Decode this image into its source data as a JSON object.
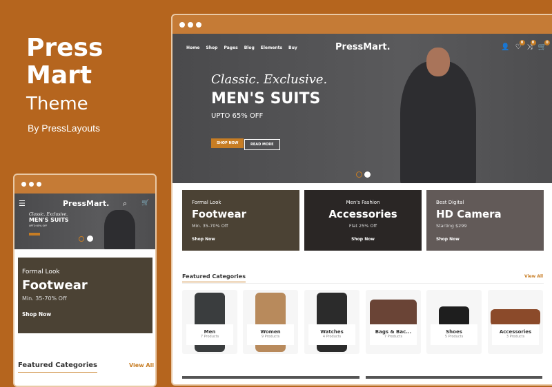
{
  "promo": {
    "title_line1": "Press",
    "title_line2": "Mart",
    "subtitle": "Theme",
    "byline": "By PressLayouts"
  },
  "desktop": {
    "nav": [
      "Home",
      "Shop",
      "Pages",
      "Blog",
      "Elements",
      "Buy"
    ],
    "logo": "PressMart.",
    "badges": {
      "wishlist": "0",
      "compare": "0",
      "cart": "0"
    },
    "hero": {
      "script": "Classic. Exclusive.",
      "headline": "MEN'S SUITS",
      "offer": "UPTO 65% OFF",
      "shop_now": "SHOP NOW",
      "read_more": "READ MORE",
      "slides": 2,
      "active_slide": 1
    },
    "banners": [
      {
        "kicker": "Formal Look",
        "title": "Footwear",
        "offer": "Min. 35-70% Off",
        "link": "Shop Now"
      },
      {
        "kicker": "Men's Fashion",
        "title": "Accessories",
        "offer": "Flat 25% Off",
        "link": "Shop Now"
      },
      {
        "kicker": "Best Digital",
        "title": "HD Camera",
        "offer": "Starting $299",
        "link": "Shop Now"
      }
    ],
    "featured": {
      "title": "Featured Categories",
      "view_all": "View All",
      "items": [
        {
          "name": "Men",
          "count": "7 Products"
        },
        {
          "name": "Women",
          "count": "9 Products"
        },
        {
          "name": "Watches",
          "count": "4 Products"
        },
        {
          "name": "Bags & Bac...",
          "count": "7 Products"
        },
        {
          "name": "Shoes",
          "count": "5 Products"
        },
        {
          "name": "Accessories",
          "count": "3 Products"
        }
      ]
    }
  },
  "mobile": {
    "logo": "PressMart.",
    "cart_badge": "0",
    "hero": {
      "script": "Classic. Exclusive.",
      "headline": "MEN'S SUITS",
      "offer": "UPTO 65% OFF"
    },
    "banner": {
      "kicker": "Formal Look",
      "title": "Footwear",
      "offer": "Min. 35-70% Off",
      "link": "Shop Now"
    },
    "featured": {
      "title": "Featured Categories",
      "view_all": "View All"
    }
  },
  "colors": {
    "background": "#b5651e",
    "accent": "#c77d24",
    "hero": "#525254"
  }
}
